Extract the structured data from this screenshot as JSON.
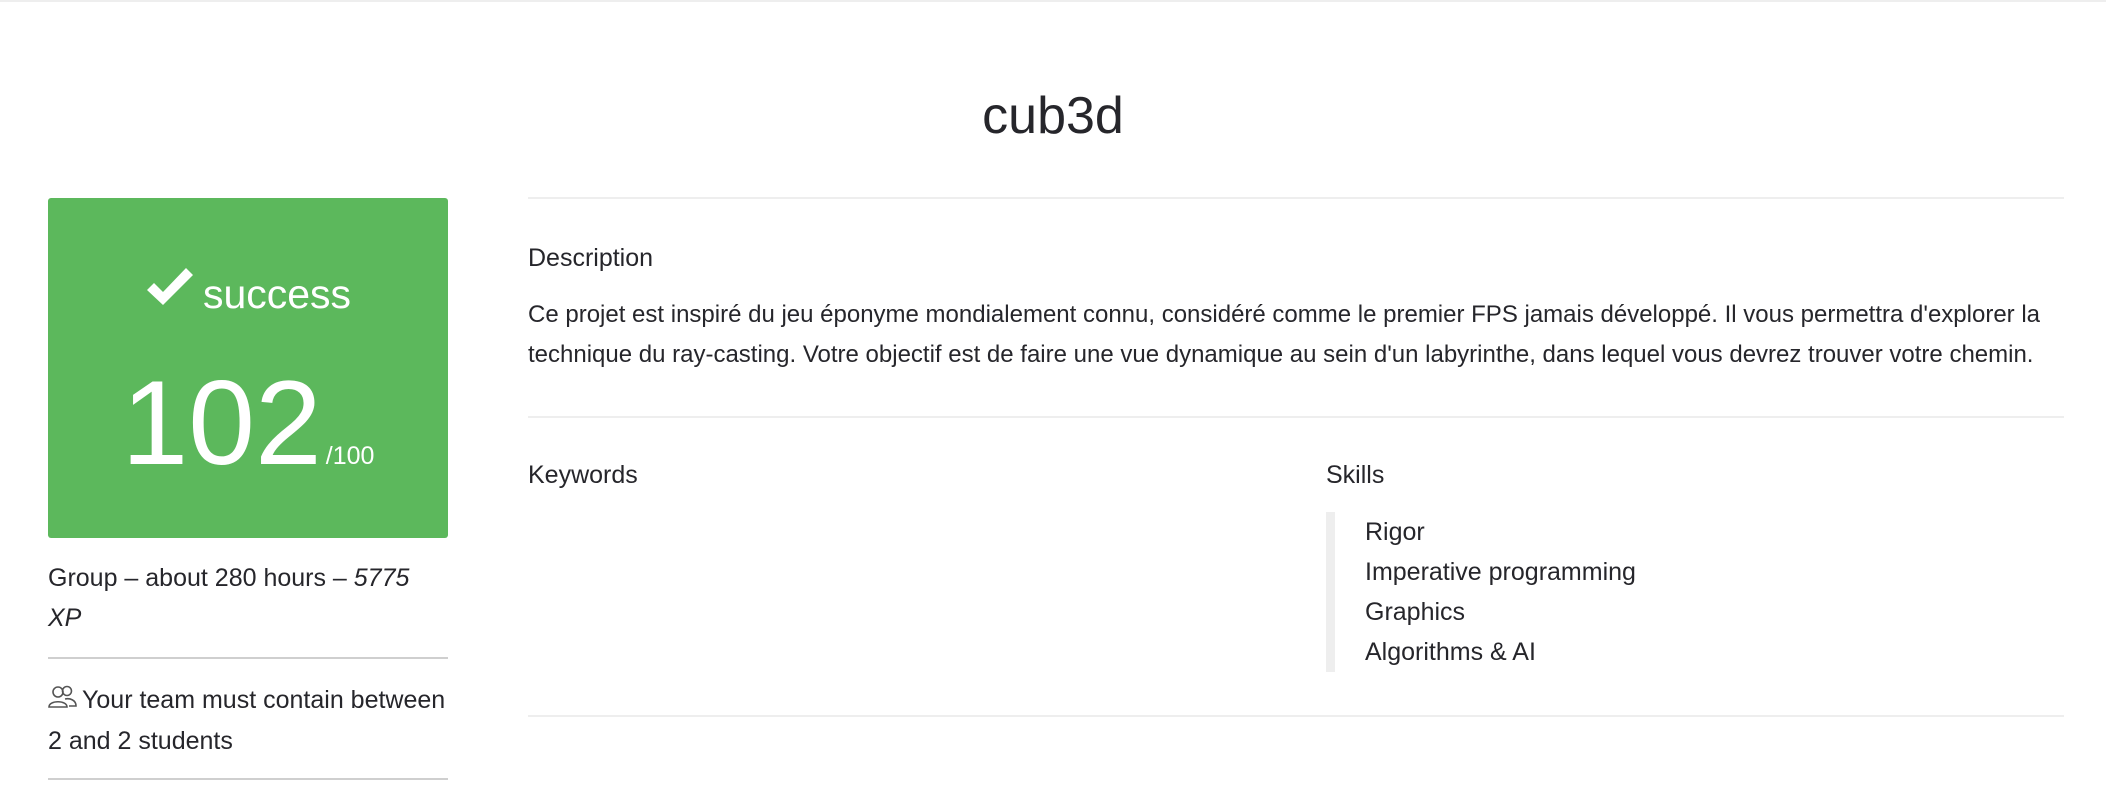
{
  "project": {
    "title": "cub3d"
  },
  "status": {
    "label": "success",
    "icon": "checkmark-icon",
    "score": "102",
    "score_max": "/100",
    "card_color": "#5cb85c"
  },
  "meta": {
    "summary": "Group – about 280 hours –",
    "xp": "5775 XP"
  },
  "team": {
    "icon": "team-icon",
    "text": "Your team must contain between 2 and 2 students"
  },
  "description": {
    "heading": "Description",
    "text": "Ce projet est inspiré du jeu éponyme mondialement connu, considéré comme le premier FPS jamais développé. Il vous permettra d'explorer la technique du ray-casting. Votre objectif est de faire une vue dynamique au sein d'un labyrinthe, dans lequel vous devrez trouver votre chemin."
  },
  "keywords": {
    "heading": "Keywords",
    "items": []
  },
  "skills": {
    "heading": "Skills",
    "items": [
      "Rigor",
      "Imperative programming",
      "Graphics",
      "Algorithms & AI"
    ]
  }
}
